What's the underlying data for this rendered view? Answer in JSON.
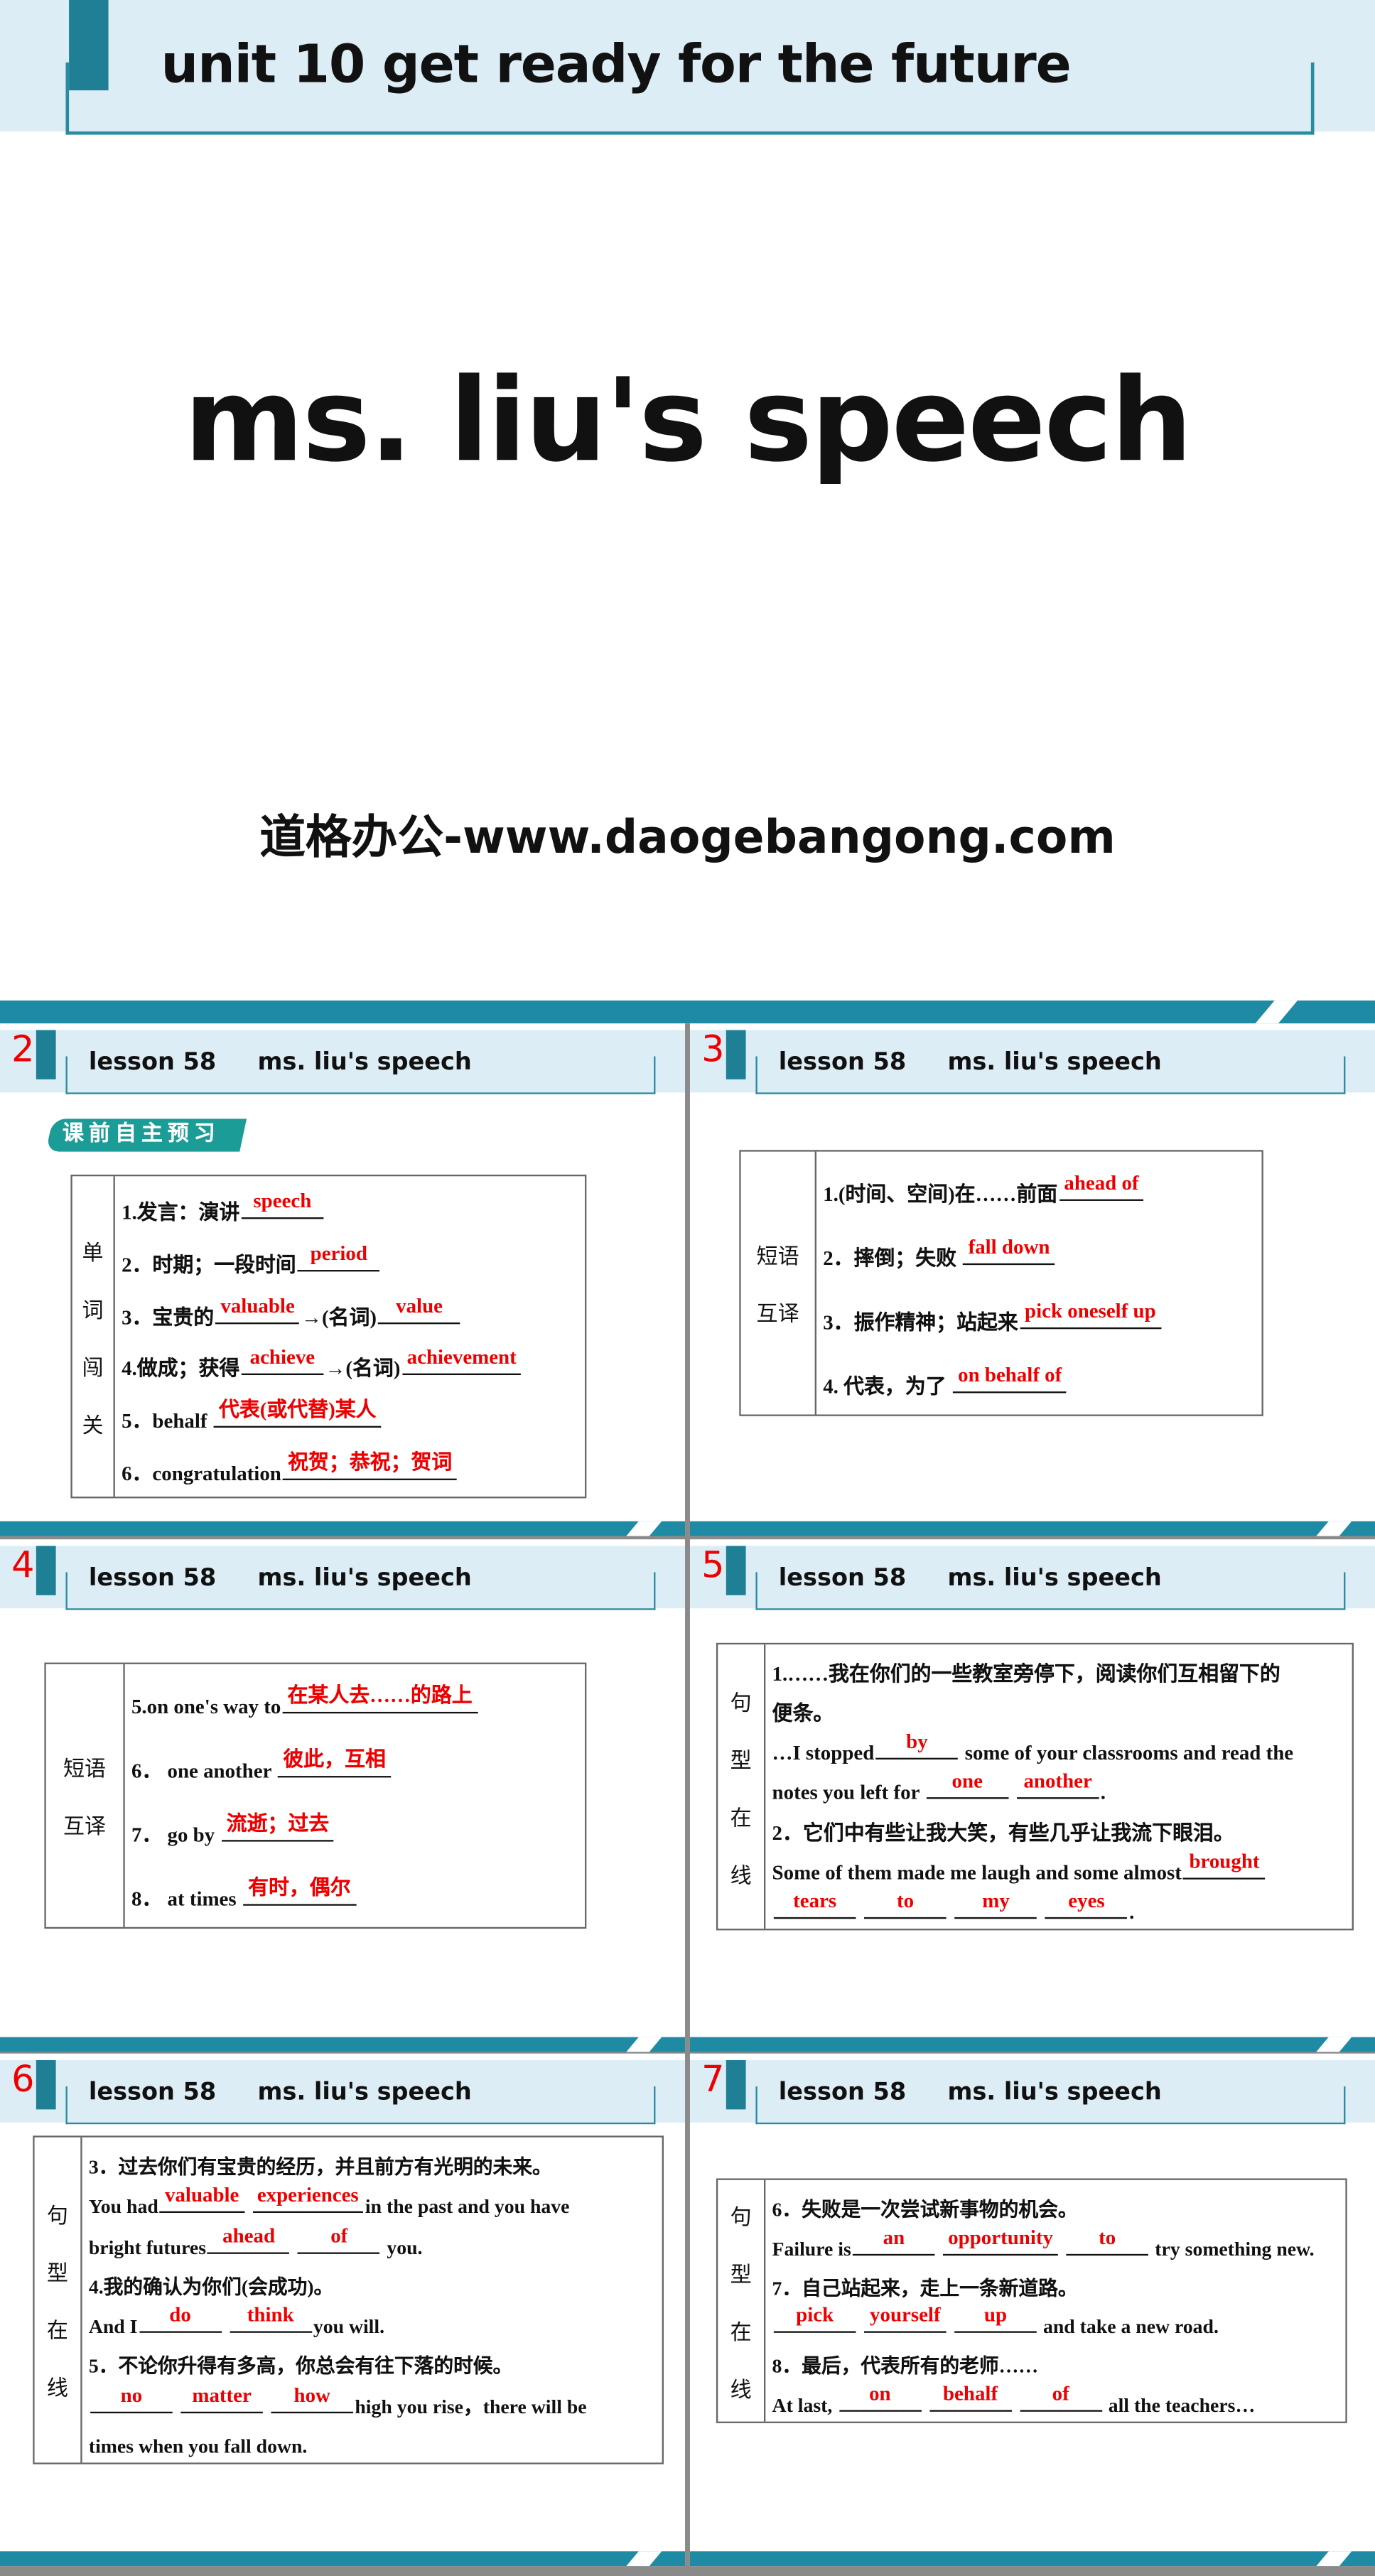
{
  "cover": {
    "unit_title": "unit 10  get ready for the future",
    "title": "ms. liu's speech",
    "subtitle": "道格办公-www.daogebangong.com"
  },
  "colors": {
    "accent": "#1e8aa3",
    "header_band": "#dcedf6",
    "answer": "#e00000",
    "number": "#e00000"
  },
  "panels": [
    {
      "number": "2",
      "lesson": "lesson 58",
      "title": "ms. liu's speech",
      "badge": "课前自主预习",
      "side": [
        "单",
        "词",
        "闯",
        "关"
      ],
      "lines": [
        [
          {
            "t": "1.发言：演讲"
          },
          {
            "a": "speech"
          }
        ],
        [
          {
            "t": "2．时期；一段时间"
          },
          {
            "a": "period"
          }
        ],
        [
          {
            "t": "3．宝贵的"
          },
          {
            "a": "valuable"
          },
          {
            "t": "→(名词)"
          },
          {
            "a": "value"
          }
        ],
        [
          {
            "t": "4.做成；获得"
          },
          {
            "a": "achieve"
          },
          {
            "t": "→(名词)"
          },
          {
            "a": "achievement"
          }
        ],
        [
          {
            "t": "5．behalf "
          },
          {
            "a": "代表(或代替)某人"
          }
        ],
        [
          {
            "t": "6．congratulation"
          },
          {
            "a": "祝贺；恭祝；贺词"
          }
        ]
      ]
    },
    {
      "number": "3",
      "lesson": "lesson 58",
      "title": "ms. liu's speech",
      "side": [
        "短语",
        "互译"
      ],
      "lines": [
        [
          {
            "t": "1.(时间、空间)在……前面"
          },
          {
            "a": "ahead of"
          }
        ],
        [
          {
            "t": "2．摔倒；失败 "
          },
          {
            "a": "fall down"
          }
        ],
        [
          {
            "t": "3．振作精神；站起来"
          },
          {
            "a": "pick oneself up"
          }
        ],
        [
          {
            "t": "4. 代表，为了 "
          },
          {
            "a": "on behalf of"
          }
        ]
      ]
    },
    {
      "number": "4",
      "lesson": "lesson 58",
      "title": "ms. liu's speech",
      "side": [
        "短语",
        "互译"
      ],
      "lines": [
        [
          {
            "t": "5.on one's way to"
          },
          {
            "a": "在某人去……的路上"
          }
        ],
        [
          {
            "t": "6． one another "
          },
          {
            "a": "彼此，互相"
          }
        ],
        [
          {
            "t": "7． go by "
          },
          {
            "a": "流逝；过去"
          }
        ],
        [
          {
            "t": "8． at times "
          },
          {
            "a": "有时，偶尔"
          }
        ]
      ]
    },
    {
      "number": "5",
      "lesson": "lesson 58",
      "title": "ms. liu's speech",
      "side": [
        "句",
        "型",
        "在",
        "线"
      ],
      "lines": [
        [
          {
            "t": "1.……我在你们的一些教室旁停下，阅读你们互相留下的"
          }
        ],
        [
          {
            "t": "便条。"
          }
        ],
        [
          {
            "t": "…I stopped"
          },
          {
            "a": "by"
          },
          {
            "t": " some of your classrooms and read the"
          }
        ],
        [
          {
            "t": "notes you left for "
          },
          {
            "a": "one"
          },
          {
            "t": " "
          },
          {
            "a": "another"
          },
          {
            "t": "."
          }
        ],
        [
          {
            "t": "2．它们中有些让我大笑，有些几乎让我流下眼泪。"
          }
        ],
        [
          {
            "t": "Some of them made me laugh and some almost"
          },
          {
            "a": "brought"
          }
        ],
        [
          {
            "a": "tears"
          },
          {
            "t": " "
          },
          {
            "a": "to"
          },
          {
            "t": " "
          },
          {
            "a": "my"
          },
          {
            "t": " "
          },
          {
            "a": "eyes"
          },
          {
            "t": "."
          }
        ]
      ]
    },
    {
      "number": "6",
      "lesson": "lesson 58",
      "title": "ms. liu's speech",
      "side": [
        "句",
        "型",
        "在",
        "线"
      ],
      "lines": [
        [
          {
            "t": "3．过去你们有宝贵的经历，并且前方有光明的未来。"
          }
        ],
        [
          {
            "t": "You had"
          },
          {
            "a": "valuable"
          },
          {
            "t": " "
          },
          {
            "a": "experiences"
          },
          {
            "t": "in the past and you have"
          }
        ],
        [
          {
            "t": "bright futures"
          },
          {
            "a": "ahead"
          },
          {
            "t": " "
          },
          {
            "a": "of"
          },
          {
            "t": "  you."
          }
        ],
        [
          {
            "t": "4.我的确认为你们(会成功)。"
          }
        ],
        [
          {
            "t": "And I"
          },
          {
            "a": "do"
          },
          {
            "t": " "
          },
          {
            "a": "think"
          },
          {
            "t": "you will."
          }
        ],
        [
          {
            "t": "5．不论你升得有多高，你总会有往下落的时候。"
          }
        ],
        [
          {
            "a": "no"
          },
          {
            "t": " "
          },
          {
            "a": "matter"
          },
          {
            "t": " "
          },
          {
            "a": "how"
          },
          {
            "t": "high you rise，there will be"
          }
        ],
        [
          {
            "t": "times when you fall down."
          }
        ]
      ]
    },
    {
      "number": "7",
      "lesson": "lesson 58",
      "title": "ms. liu's speech",
      "side": [
        "句",
        "型",
        "在",
        "线"
      ],
      "lines": [
        [
          {
            "t": "6．失败是一次尝试新事物的机会。"
          }
        ],
        [
          {
            "t": "Failure is"
          },
          {
            "a": "an"
          },
          {
            "t": " "
          },
          {
            "a": "opportunity"
          },
          {
            "t": " "
          },
          {
            "a": "to"
          },
          {
            "t": " try something new."
          }
        ],
        [
          {
            "t": "7．自己站起来，走上一条新道路。"
          }
        ],
        [
          {
            "a": "pick"
          },
          {
            "t": " "
          },
          {
            "a": "yourself"
          },
          {
            "t": " "
          },
          {
            "a": "up"
          },
          {
            "t": " and take a new road."
          }
        ],
        [
          {
            "t": "8．最后，代表所有的老师……"
          }
        ],
        [
          {
            "t": "At last, "
          },
          {
            "a": "on"
          },
          {
            "t": " "
          },
          {
            "a": "behalf"
          },
          {
            "t": " "
          },
          {
            "a": "of"
          },
          {
            "t": " all the teachers…"
          }
        ]
      ]
    }
  ]
}
